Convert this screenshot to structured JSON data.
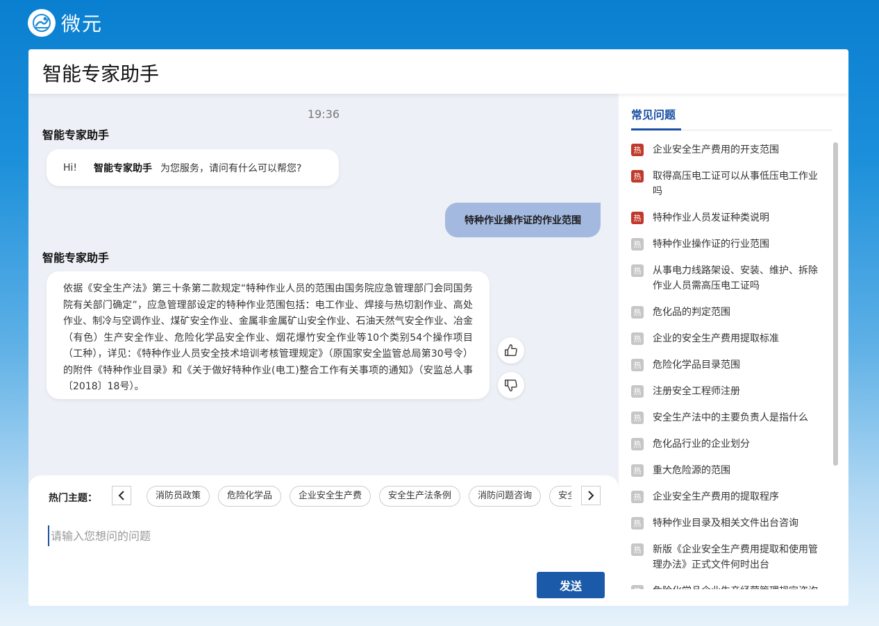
{
  "brand": {
    "name": "微元"
  },
  "app": {
    "title": "智能专家助手"
  },
  "chat": {
    "timestamp": "19:36",
    "messages": [
      {
        "role": "bot",
        "sender": "智能专家助手",
        "greeting_hi": "Hi!",
        "greeting_name": "智能专家助手",
        "greeting_rest": "为您服务，请问有什么可以帮您?"
      },
      {
        "role": "user",
        "text": "特种作业操作证的作业范围"
      },
      {
        "role": "bot",
        "sender": "智能专家助手",
        "text": "依据《安全生产法》第三十条第二款规定“特种作业人员的范围由国务院应急管理部门会同国务院有关部门确定”，应急管理部设定的特种作业范围包括：电工作业、焊接与热切割作业、高处作业、制冷与空调作业、煤矿安全作业、金属非金属矿山安全作业、石油天然气安全作业、冶金（有色）生产安全作业、危险化学品安全作业、烟花爆竹安全作业等10个类别54个操作项目（工种），详见：《特种作业人员安全技术培训考核管理规定》（原国家安全监管总局第30号令）的附件《特种作业目录》和《关于做好特种作业(电工)整合工作有关事项的通知》（安监总人事〔2018〕18号）。"
      }
    ]
  },
  "input": {
    "topics_label": "热门主题：",
    "topics": [
      "消防员政策",
      "危险化学品",
      "企业安全生产费",
      "安全生产法条例",
      "消防问题咨询",
      "安全"
    ],
    "placeholder": "请输入您想问的问题",
    "value": "",
    "send_label": "发送"
  },
  "faq": {
    "title": "常见问题",
    "hot_label": "热",
    "items": [
      {
        "text": "企业安全生产费用的开支范围",
        "hot": true
      },
      {
        "text": "取得高压电工证可以从事低压电工作业吗",
        "hot": true
      },
      {
        "text": "特种作业人员发证种类说明",
        "hot": true
      },
      {
        "text": "特种作业操作证的行业范围",
        "hot": false
      },
      {
        "text": "从事电力线路架设、安装、维护、拆除作业人员需高压电工证吗",
        "hot": false
      },
      {
        "text": "危化品的判定范围",
        "hot": false
      },
      {
        "text": "企业的安全生产费用提取标准",
        "hot": false
      },
      {
        "text": "危险化学品目录范围",
        "hot": false
      },
      {
        "text": "注册安全工程师注册",
        "hot": false
      },
      {
        "text": "安全生产法中的主要负责人是指什么",
        "hot": false
      },
      {
        "text": "危化品行业的企业划分",
        "hot": false
      },
      {
        "text": "重大危险源的范围",
        "hot": false
      },
      {
        "text": "企业安全生产费用的提取程序",
        "hot": false
      },
      {
        "text": "特种作业目录及相关文件出台咨询",
        "hot": false
      },
      {
        "text": "新版《企业安全生产费用提取和使用管理办法》正式文件何时出台",
        "hot": false
      },
      {
        "text": "危险化学品企业生产经营管理规定咨询",
        "hot": false
      }
    ]
  },
  "colors": {
    "accent": "#1a4fa3",
    "hot_active": "#c0392b",
    "hot_inactive": "#c6c6c6",
    "user_bubble": "#a4b9e0",
    "chat_bg": "#edf0f6"
  }
}
